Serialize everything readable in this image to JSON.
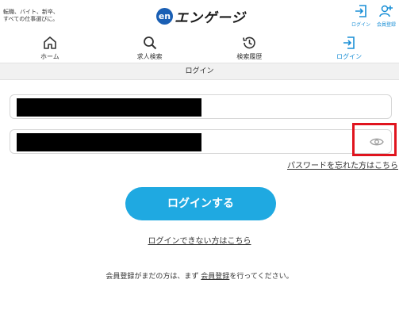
{
  "header": {
    "tagline_line1": "転職、バイト、新卒、",
    "tagline_line2": "すべての仕事選びに。",
    "logo_mark": "en",
    "logo_text": "エンゲージ",
    "login_label": "ログイン",
    "register_label": "会員登録"
  },
  "nav": {
    "items": [
      {
        "label": "ホーム",
        "icon": "home-icon"
      },
      {
        "label": "求人検索",
        "icon": "search-icon"
      },
      {
        "label": "検索履歴",
        "icon": "history-icon"
      },
      {
        "label": "ログイン",
        "icon": "login-icon",
        "active": true
      }
    ]
  },
  "page": {
    "section_title": "ログイン",
    "forgot_password": "パスワードを忘れた方はこちら",
    "login_button": "ログインする",
    "cant_login": "ログインできない方はこちら",
    "register_note_prefix": "会員登録がまだの方は、まず",
    "register_link": "会員登録",
    "register_note_suffix": "を行ってください。"
  },
  "colors": {
    "accent": "#1fa9e1",
    "link_blue": "#1a8fd6",
    "highlight": "#e0141e"
  }
}
